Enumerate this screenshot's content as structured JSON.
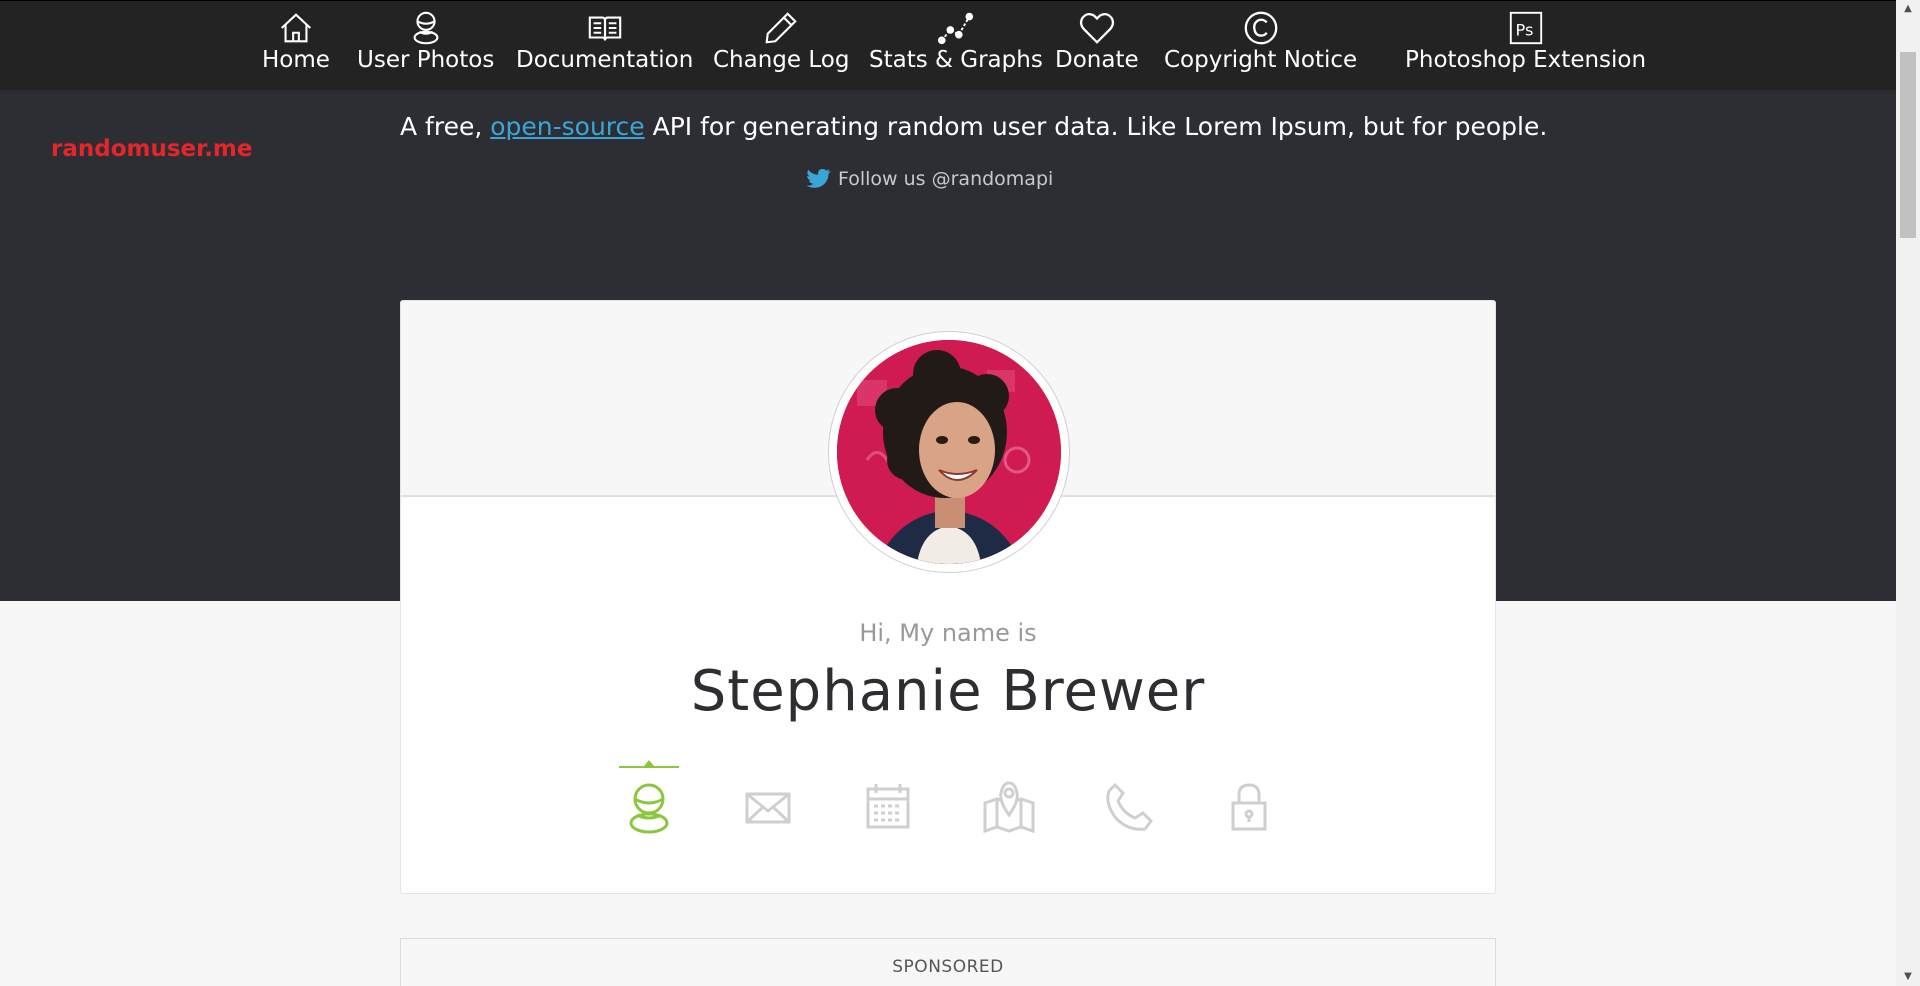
{
  "nav": {
    "items": [
      {
        "label": "Home",
        "icon": "home-icon"
      },
      {
        "label": "User Photos",
        "icon": "user-icon"
      },
      {
        "label": "Documentation",
        "icon": "book-icon"
      },
      {
        "label": "Change Log",
        "icon": "pencil-icon"
      },
      {
        "label": "Stats & Graphs",
        "icon": "graph-icon"
      },
      {
        "label": "Donate",
        "icon": "heart-icon"
      },
      {
        "label": "Copyright Notice",
        "icon": "copyright-icon"
      },
      {
        "label": "Photoshop Extension",
        "icon": "photoshop-icon"
      }
    ]
  },
  "brand": "randomuser.me",
  "hero": {
    "tagline_pre": "A free, ",
    "tagline_link": "open-source",
    "tagline_post": " API for generating random user data. Like Lorem Ipsum, but for people.",
    "follow_text": "Follow us @randomapi"
  },
  "card": {
    "greeting": "Hi, My name is",
    "name": "Stephanie Brewer",
    "tabs": [
      {
        "icon": "user-icon",
        "active": true
      },
      {
        "icon": "envelope-icon",
        "active": false
      },
      {
        "icon": "calendar-icon",
        "active": false
      },
      {
        "icon": "map-icon",
        "active": false
      },
      {
        "icon": "phone-icon",
        "active": false
      },
      {
        "icon": "lock-icon",
        "active": false
      }
    ]
  },
  "sponsored": "SPONSORED",
  "colors": {
    "nav_bg": "#232323",
    "hero_bg": "#2d2e33",
    "brand": "#e4252a",
    "link": "#3aa6d8",
    "active_tab": "#8cc63f",
    "inactive_tab": "#cfcfcf"
  }
}
